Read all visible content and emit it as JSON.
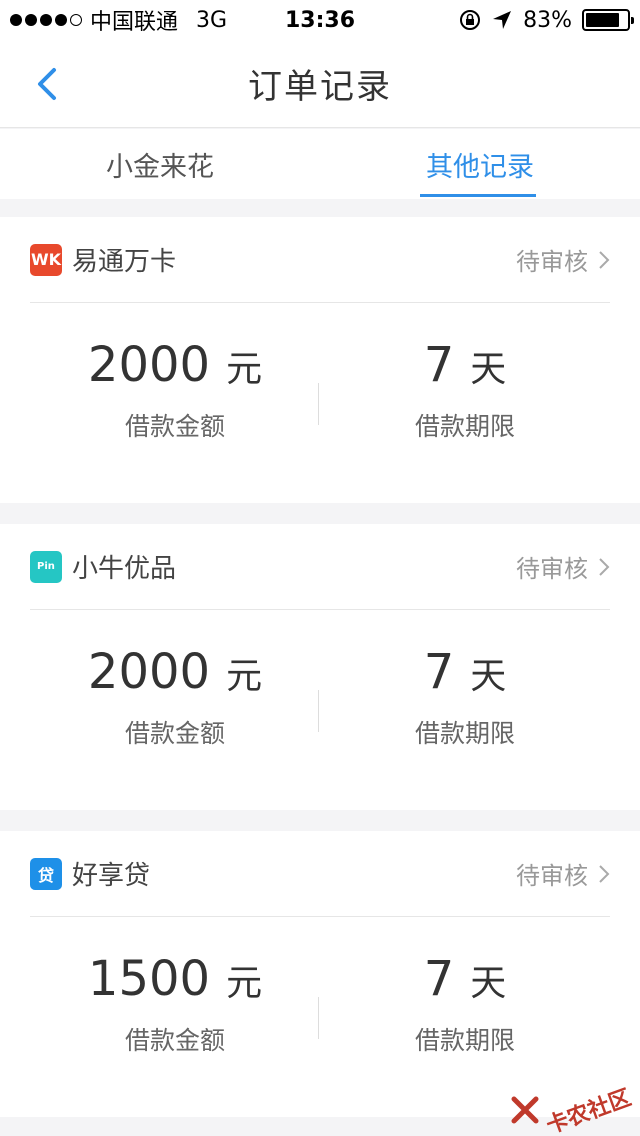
{
  "status_bar": {
    "carrier": "中国联通",
    "network": "3G",
    "time": "13:36",
    "battery": "83%",
    "battery_level": 0.83
  },
  "nav": {
    "title": "订单记录"
  },
  "tabs": [
    {
      "label": "小金来花",
      "active": false
    },
    {
      "label": "其他记录",
      "active": true
    }
  ],
  "orders": [
    {
      "brand": "易通万卡",
      "logo_text": "WK",
      "status": "待审核",
      "amount": "2000",
      "amount_unit": "元",
      "amount_label": "借款金额",
      "term": "7",
      "term_unit": "天",
      "term_label": "借款期限"
    },
    {
      "brand": "小牛优品",
      "logo_text": "Pin",
      "status": "待审核",
      "amount": "2000",
      "amount_unit": "元",
      "amount_label": "借款金额",
      "term": "7",
      "term_unit": "天",
      "term_label": "借款期限"
    },
    {
      "brand": "好享贷",
      "logo_text": "贷",
      "status": "待审核",
      "amount": "1500",
      "amount_unit": "元",
      "amount_label": "借款金额",
      "term": "7",
      "term_unit": "天",
      "term_label": "借款期限"
    }
  ],
  "watermark": "卡农社区",
  "colors": {
    "accent": "#2f8fe8",
    "wk_logo": "#e8492c",
    "pin_logo": "#25c6c4",
    "dai_logo": "#1e90e8"
  }
}
